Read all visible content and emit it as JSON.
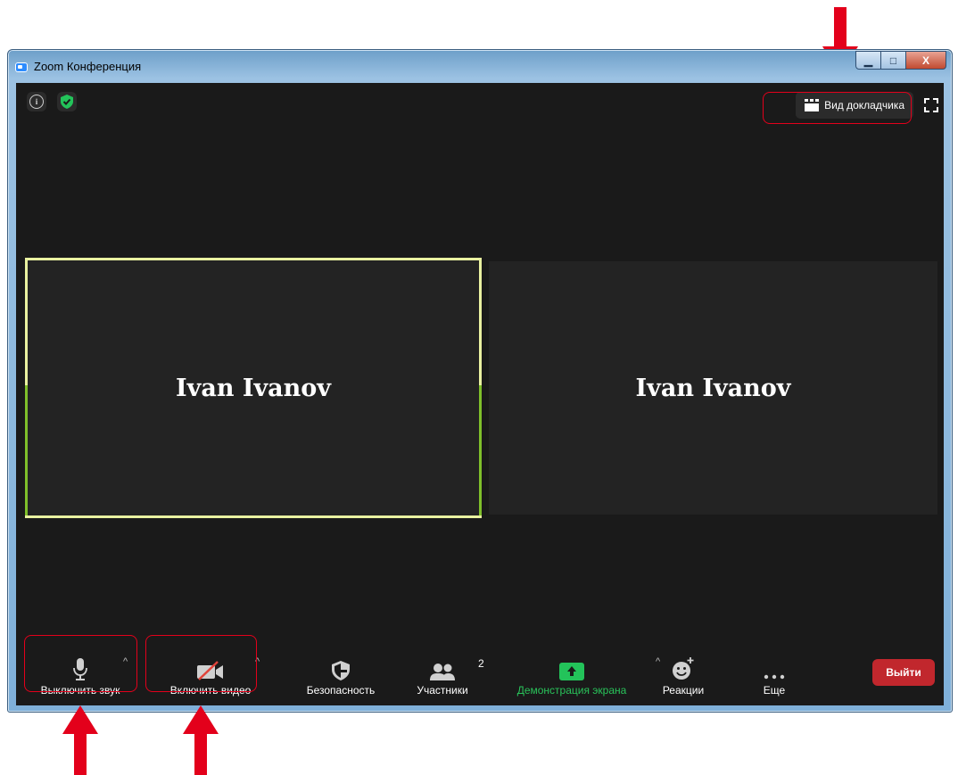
{
  "window": {
    "title": "Zoom Конференция",
    "minimize_glyph": "▁",
    "maximize_glyph": "□",
    "close_glyph": "X"
  },
  "header": {
    "speaker_view_label": "Вид докладчика"
  },
  "participants": [
    {
      "name": "Ivan Ivanov",
      "active": true
    },
    {
      "name": "Ivan Ivanov",
      "active": false
    }
  ],
  "toolbar": {
    "mute_label": "Выключить звук",
    "video_label": "Включить видео",
    "security_label": "Безопасность",
    "participants_label": "Участники",
    "participants_count": "2",
    "share_label": "Демонстрация экрана",
    "reactions_label": "Реакции",
    "more_label": "Еще",
    "leave_label": "Выйти",
    "caret": "^"
  },
  "colors": {
    "accent_share": "#29c35a",
    "leave": "#c1272d",
    "active_border": "#e9f1a0",
    "annotation_red": "#e3001b"
  }
}
